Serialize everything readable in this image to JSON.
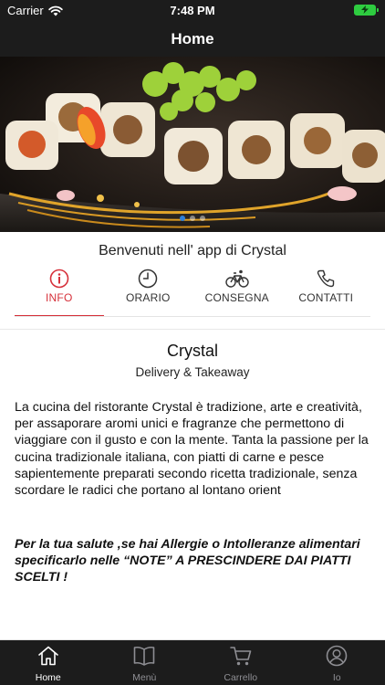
{
  "status_bar": {
    "carrier": "Carrier",
    "time": "7:48 PM",
    "icons": [
      "wifi-icon",
      "battery-charging-icon"
    ],
    "battery_color": "#2ecc40"
  },
  "nav": {
    "title": "Home"
  },
  "hero": {
    "slides": 3,
    "active_slide": 1,
    "image": "sushi-rolls-photo"
  },
  "welcome_text": "Benvenuti nell' app di Crystal",
  "tabs": [
    {
      "label": "INFO",
      "icon": "info-icon",
      "active": true
    },
    {
      "label": "ORARIO",
      "icon": "clock-icon",
      "active": false
    },
    {
      "label": "CONSEGNA",
      "icon": "bicycle-icon",
      "active": false
    },
    {
      "label": "CONTATTI",
      "icon": "phone-icon",
      "active": false
    }
  ],
  "info": {
    "name": "Crystal",
    "subtitle": "Delivery & Takeaway",
    "description": "La cucina del ristorante Crystal è tradizione, arte e creatività, per assaporare aromi unici e fragranze che permettono di viaggiare con il gusto e con la mente. Tanta la passione per la cucina tradizionale italiana, con piatti di carne e pesce sapientemente preparati secondo ricetta tradizionale, senza scordare le radici che portano al lontano orient",
    "notice": "Per la tua salute ,se hai Allergie o Intolleranze alimentari specificarlo nelle “NOTE” A PRESCINDERE DAI PIATTI SCELTI !"
  },
  "tab_bar": [
    {
      "label": "Home",
      "icon": "home-icon",
      "active": true
    },
    {
      "label": "Menù",
      "icon": "book-icon",
      "active": false
    },
    {
      "label": "Carrello",
      "icon": "cart-icon",
      "active": false
    },
    {
      "label": "Io",
      "icon": "user-icon",
      "active": false
    }
  ],
  "colors": {
    "accent": "#d6303a",
    "bar_background": "#1c1c1c",
    "tab_bar_inactive": "#8e8e93"
  }
}
